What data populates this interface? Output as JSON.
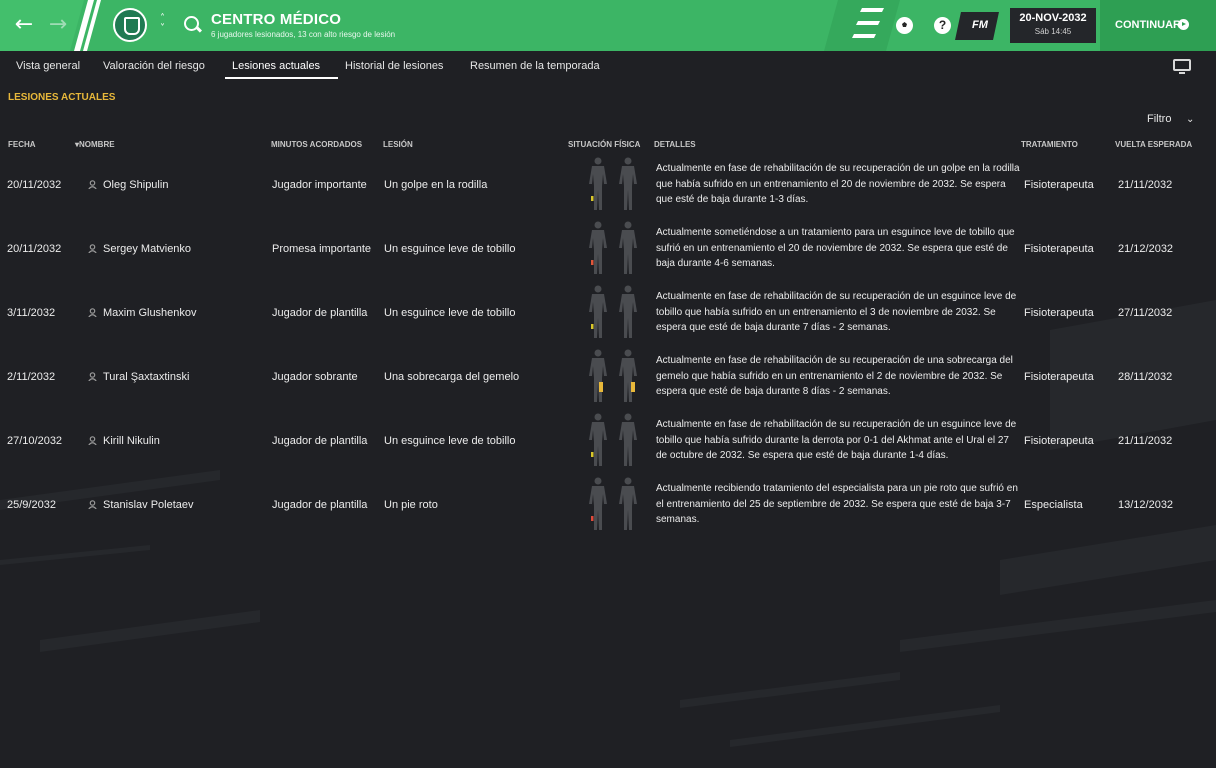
{
  "header": {
    "title": "CENTRO MÉDICO",
    "subtitle": "6 jugadores lesionados, 13 con alto riesgo de lesión",
    "date": "20-NOV-2032",
    "time": "Sáb 14:45",
    "fm_label": "FM",
    "continue_label": "CONTINUAR",
    "help_label": "?"
  },
  "tabs": [
    "Vista general",
    "Valoración del riesgo",
    "Lesiones actuales",
    "Historial de lesiones",
    "Resumen de la temporada"
  ],
  "active_tab": "Lesiones actuales",
  "section_title": "LESIONES ACTUALES",
  "filter_label": "Filtro",
  "columns": {
    "fecha": "FECHA",
    "nombre": "NOMBRE",
    "minutos": "MINUTOS ACORDADOS",
    "lesion": "LESIÓN",
    "situacion": "SITUACIÓN FÍSICA",
    "detalles": "DETALLES",
    "tratamiento": "TRATAMIENTO",
    "vuelta": "VUELTA ESPERADA"
  },
  "rows": [
    {
      "fecha": "20/11/2032",
      "nombre": "Oleg Shipulin",
      "minutos": "Jugador importante",
      "lesion": "Un golpe en la rodilla",
      "detalles": "Actualmente en fase de rehabilitación de su recuperación de un golpe en la rodilla que había sufrido en un entrenamiento el 20 de noviembre de 2032. Se espera que esté de baja durante 1-3 días.",
      "tratamiento": "Fisioterapeuta",
      "vuelta": "21/11/2032",
      "injury_color": "#d8c62a"
    },
    {
      "fecha": "20/11/2032",
      "nombre": "Sergey Matvienko",
      "minutos": "Promesa importante",
      "lesion": "Un esguince leve de tobillo",
      "detalles": "Actualmente sometiéndose a un tratamiento para un esguince leve de tobillo que sufrió en un entrenamiento el 20 de noviembre de 2032. Se espera que esté de baja durante 4-6 semanas.",
      "tratamiento": "Fisioterapeuta",
      "vuelta": "21/12/2032",
      "injury_color": "#e0563a"
    },
    {
      "fecha": "3/11/2032",
      "nombre": "Maxim Glushenkov",
      "minutos": "Jugador de plantilla",
      "lesion": "Un esguince leve de tobillo",
      "detalles": "Actualmente en fase de rehabilitación de su recuperación de un esguince leve de tobillo que había sufrido en un entrenamiento el 3 de noviembre de 2032. Se espera que esté de baja durante 7 días - 2 semanas.",
      "tratamiento": "Fisioterapeuta",
      "vuelta": "27/11/2032",
      "injury_color": "#d8c62a"
    },
    {
      "fecha": "2/11/2032",
      "nombre": "Tural Şaxtaxtinski",
      "minutos": "Jugador sobrante",
      "lesion": "Una sobrecarga del gemelo",
      "detalles": "Actualmente en fase de rehabilitación de su recuperación de una sobrecarga del gemelo que había sufrido en un entrenamiento el 2 de noviembre de 2032. Se espera que esté de baja durante 8 días - 2 semanas.",
      "tratamiento": "Fisioterapeuta",
      "vuelta": "28/11/2032",
      "injury_color": "#e8b83a"
    },
    {
      "fecha": "27/10/2032",
      "nombre": "Kirill Nikulin",
      "minutos": "Jugador de plantilla",
      "lesion": "Un esguince leve de tobillo",
      "detalles": "Actualmente en fase de rehabilitación de su recuperación de un esguince leve de tobillo que había sufrido durante la derrota por 0-1 del Akhmat ante el Ural el 27 de octubre de 2032. Se espera que esté de baja durante 1-4 días.",
      "tratamiento": "Fisioterapeuta",
      "vuelta": "21/11/2032",
      "injury_color": "#d8c62a"
    },
    {
      "fecha": "25/9/2032",
      "nombre": "Stanislav Poletaev",
      "minutos": "Jugador de plantilla",
      "lesion": "Un pie roto",
      "detalles": "Actualmente recibiendo tratamiento del especialista para un pie roto que sufrió en el entrenamiento del 25 de septiembre de 2032. Se espera que esté de baja 3-7 semanas.",
      "tratamiento": "Especialista",
      "vuelta": "13/12/2032",
      "injury_color": "#e04a3a"
    }
  ],
  "colors": {
    "accent": "#3cb565",
    "background": "#1f2024",
    "section_title": "#e8b83a"
  },
  "icons": [
    "back-arrow-icon",
    "forward-arrow-icon",
    "club-crest-icon",
    "up-down-chevron-icon",
    "search-icon",
    "football-icon",
    "help-icon",
    "screen-icon",
    "chevron-down-icon",
    "person-icon",
    "body-figure-icon"
  ]
}
